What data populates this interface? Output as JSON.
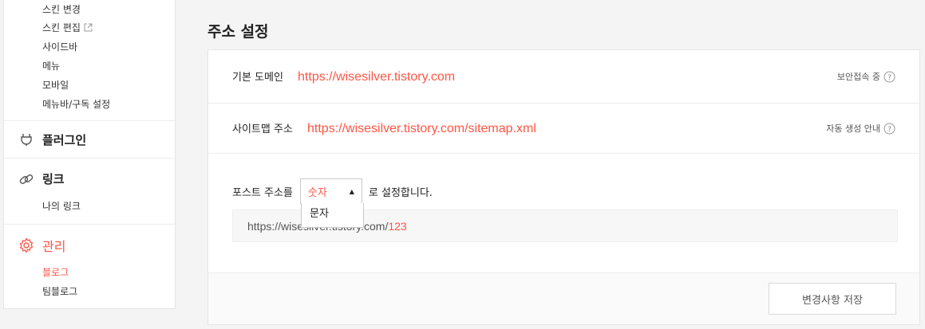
{
  "sidebar": {
    "top_items": [
      {
        "label": "스킨 변경"
      },
      {
        "label": "스킨 편집",
        "external": true
      },
      {
        "label": "사이드바"
      },
      {
        "label": "메뉴"
      },
      {
        "label": "모바일"
      },
      {
        "label": "메뉴바/구독 설정"
      }
    ],
    "plugin": {
      "title": "플러그인",
      "icon": "plug-icon"
    },
    "link": {
      "title": "링크",
      "icon": "link-icon",
      "items": [
        {
          "label": "나의 링크"
        }
      ]
    },
    "manage": {
      "title": "관리",
      "icon": "gear-icon",
      "items": [
        {
          "label": "블로그",
          "active": true
        },
        {
          "label": "팀블로그"
        }
      ]
    }
  },
  "main": {
    "title": "주소 설정",
    "domain": {
      "label": "기본 도메인",
      "url": "https://wisesilver.tistory.com",
      "status": "보안접속 중"
    },
    "sitemap": {
      "label": "사이트맵 주소",
      "url": "https://wisesilver.tistory.com/sitemap.xml",
      "status": "자동 생성 안내"
    },
    "post_url": {
      "label": "포스트 주소를",
      "selected": "숫자",
      "options": [
        "숫자",
        "문자"
      ],
      "suffix": "로 설정합니다.",
      "preview_base": "https://wisesilver.tistory.com/",
      "preview_id": "123"
    },
    "save_label": "변경사항 저장"
  },
  "colors": {
    "accent": "#ff5544"
  }
}
